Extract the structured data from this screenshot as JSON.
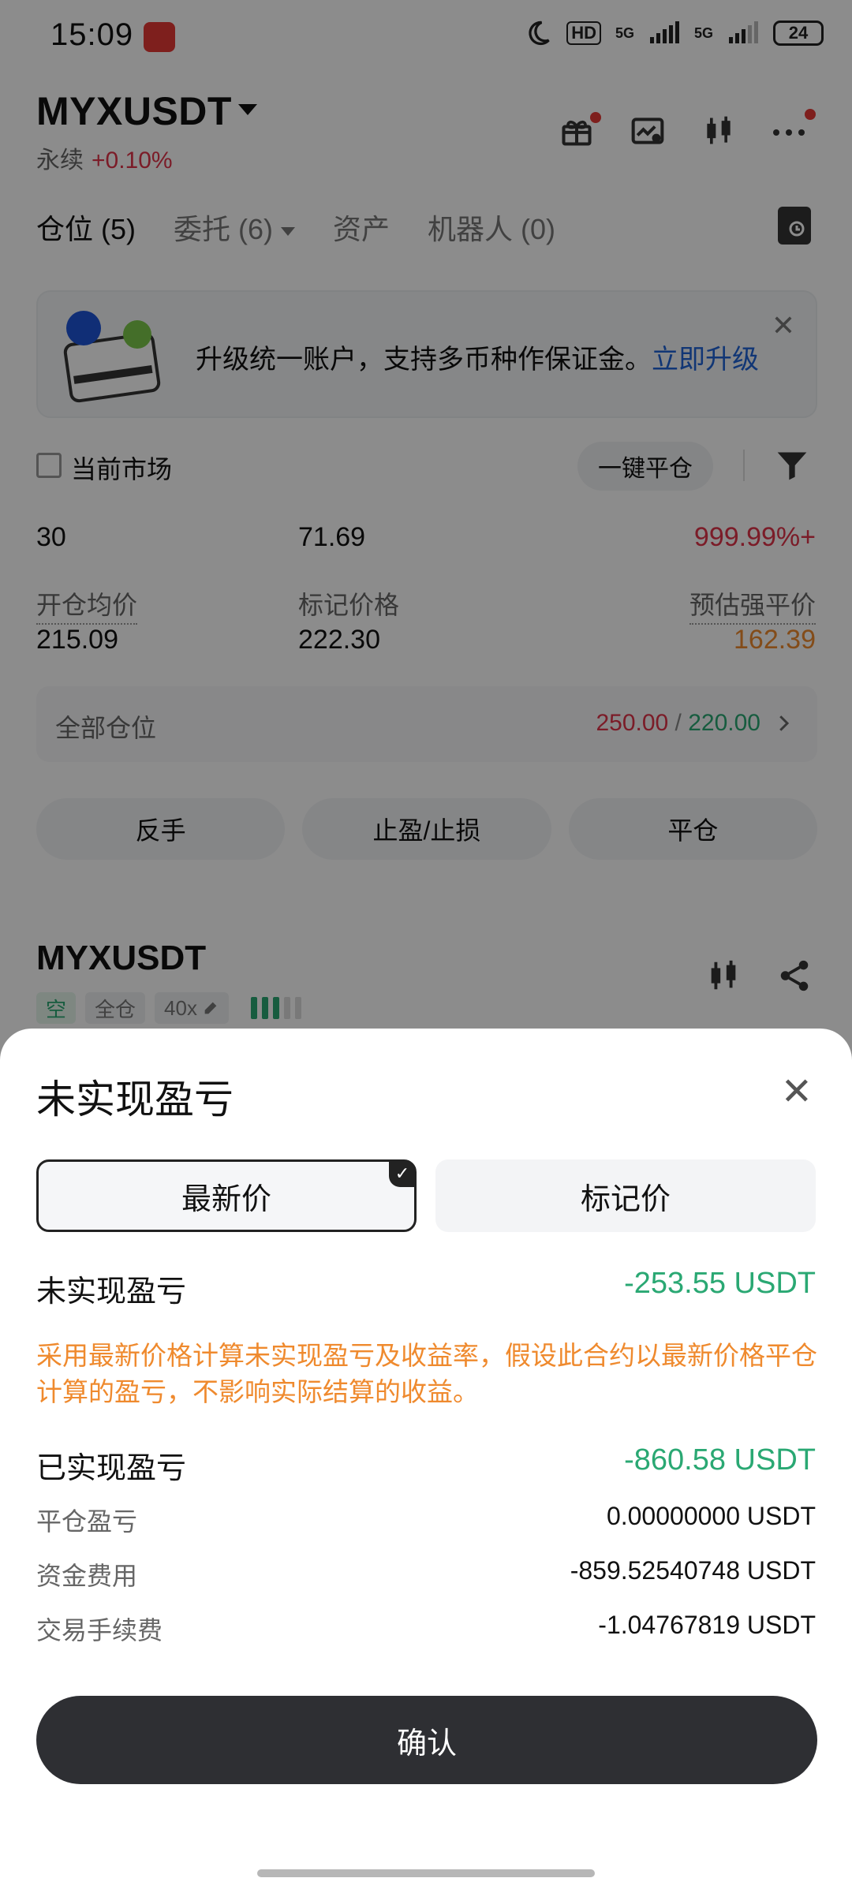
{
  "status_bar": {
    "time": "15:09",
    "network_labels": [
      "HD",
      "5G",
      "5G"
    ],
    "battery": "24"
  },
  "header": {
    "symbol": "MYXUSDT",
    "contract_type": "永续",
    "change": "+0.10%"
  },
  "tabs": [
    {
      "label": "仓位 (5)"
    },
    {
      "label": "委托 (6)"
    },
    {
      "label": "资产"
    },
    {
      "label": "机器人 (0)"
    }
  ],
  "banner": {
    "text": "升级统一账户，支持多币种作保证金。",
    "link": "立即升级"
  },
  "filters": {
    "current_market_label": "当前市场",
    "close_all_label": "一键平仓"
  },
  "position": {
    "values_row1": {
      "left": "30",
      "middle": "71.69",
      "right": "999.99%+"
    },
    "open_avg_label": "开仓均价",
    "open_avg": "215.09",
    "mark_price_label": "标记价格",
    "mark_price": "222.30",
    "liq_price_label": "预估强平价",
    "liq_price": "162.39",
    "all_positions_label": "全部仓位",
    "all_positions_red": "250.00",
    "all_positions_sep": " / ",
    "all_positions_green": "220.00",
    "buttons": {
      "reverse": "反手",
      "tp_sl": "止盈/止损",
      "close": "平仓"
    }
  },
  "position2": {
    "symbol": "MYXUSDT",
    "tags": [
      "空",
      "全仓",
      "40x"
    ]
  },
  "sheet": {
    "title": "未实现盈亏",
    "segment_left": "最新价",
    "segment_right": "标记价",
    "unrealized_label": "未实现盈亏",
    "unrealized_value": "-253.55 USDT",
    "note": "采用最新价格计算未实现盈亏及收益率，假设此合约以最新价格平仓计算的盈亏，不影响实际结算的收益。",
    "realized_label": "已实现盈亏",
    "realized_value": "-860.58 USDT",
    "details": [
      {
        "label": "平仓盈亏",
        "value": "0.00000000 USDT"
      },
      {
        "label": "资金费用",
        "value": "-859.52540748 USDT"
      },
      {
        "label": "交易手续费",
        "value": "-1.04767819 USDT"
      }
    ],
    "confirm_label": "确认"
  },
  "colors": {
    "red": "#e0334a",
    "green": "#2aa873",
    "orange": "#ef8a2e",
    "link_blue": "#1f63d6",
    "confirm_bg": "#2e2f33"
  }
}
